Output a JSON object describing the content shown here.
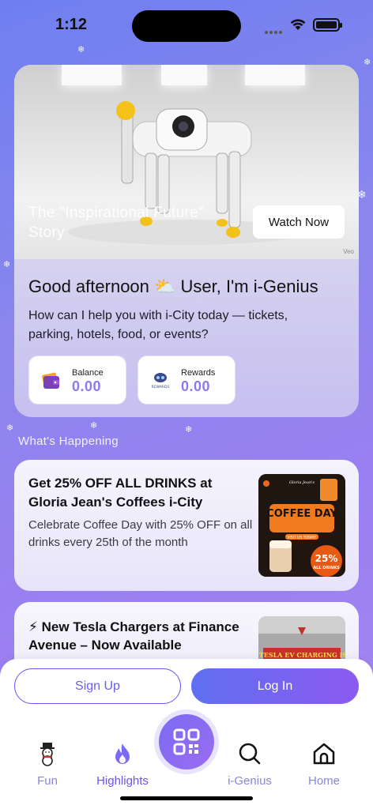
{
  "status_bar": {
    "time": "1:12"
  },
  "hero": {
    "title": "The \"Inspirational Future\" Story",
    "watch_label": "Watch Now",
    "watermark": "Veo",
    "greeting": "Good afternoon ⛅ User, I'm i-Genius",
    "subtitle": "How can I help you with i-City today — tickets, parking, hotels, food, or events?",
    "balance": {
      "label": "Balance",
      "value": "0.00"
    },
    "rewards": {
      "label": "Rewards",
      "value": "0.00",
      "icon_caption": "REWARDS"
    }
  },
  "section_title": "What's Happening",
  "promo": {
    "title": "Get 25% OFF ALL DRINKS at Gloria Jean's Coffees i-City",
    "text": "Celebrate Coffee Day with 25% OFF on all drinks every 25th of the month",
    "image": {
      "brand": "Gloria Jean's",
      "headline": "COFFEE DAY",
      "badge": "25%",
      "badge_sub": "ALL DRINKS",
      "cta": "VISIT US TODAY!"
    }
  },
  "tesla": {
    "title": "⚡ New Tesla Chargers at Finance Avenue – Now Available",
    "image": {
      "caption": "YOUR TESLA EV CHARGING IS NOW"
    }
  },
  "actions": {
    "signup_label": "Sign Up",
    "login_label": "Log In"
  },
  "nav": {
    "items": [
      {
        "label": "Fun",
        "icon": "snowman-icon"
      },
      {
        "label": "Highlights",
        "icon": "flame-icon"
      },
      {
        "label": "i-Genius",
        "icon": "search-icon"
      },
      {
        "label": "Home",
        "icon": "home-icon"
      }
    ],
    "center_icon": "qr-code-icon"
  },
  "colors": {
    "accent": "#6a55ec",
    "value": "#8d79ea",
    "login_gradient": [
      "#5f6ff0",
      "#8c5af0"
    ]
  }
}
